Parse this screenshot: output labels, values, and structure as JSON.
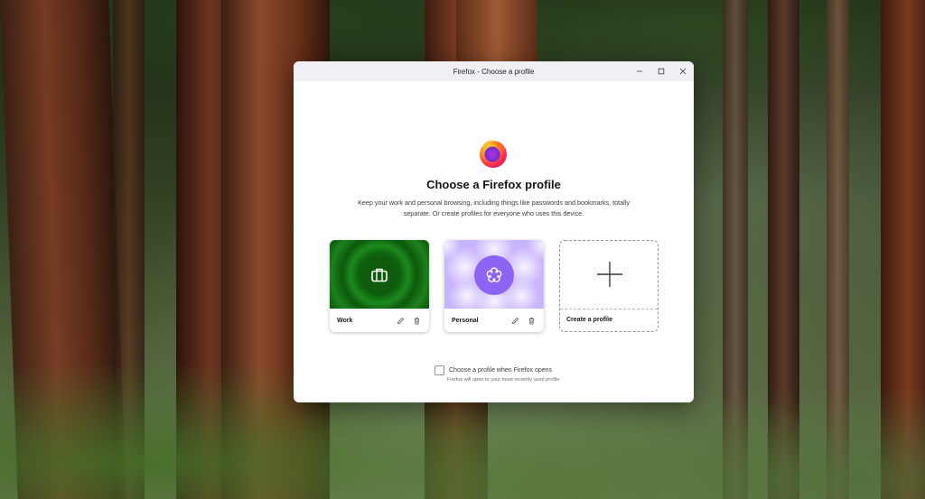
{
  "window": {
    "title": "Firefox - Choose a profile"
  },
  "dialog": {
    "heading": "Choose a Firefox profile",
    "description": "Keep your work and personal browsing, including things like passwords and bookmarks, totally separate. Or create profiles for everyone who uses this device."
  },
  "profiles": [
    {
      "name": "Work",
      "icon": "briefcase-icon",
      "theme_color": "#0f5c0f"
    },
    {
      "name": "Personal",
      "icon": "flower-icon",
      "theme_color": "#8d63f5"
    }
  ],
  "create_profile": {
    "label": "Create a profile",
    "icon": "plus-icon"
  },
  "startup_option": {
    "label": "Choose a profile when Firefox opens",
    "hint": "Firefox will open to your most recently used profile.",
    "checked": false
  }
}
